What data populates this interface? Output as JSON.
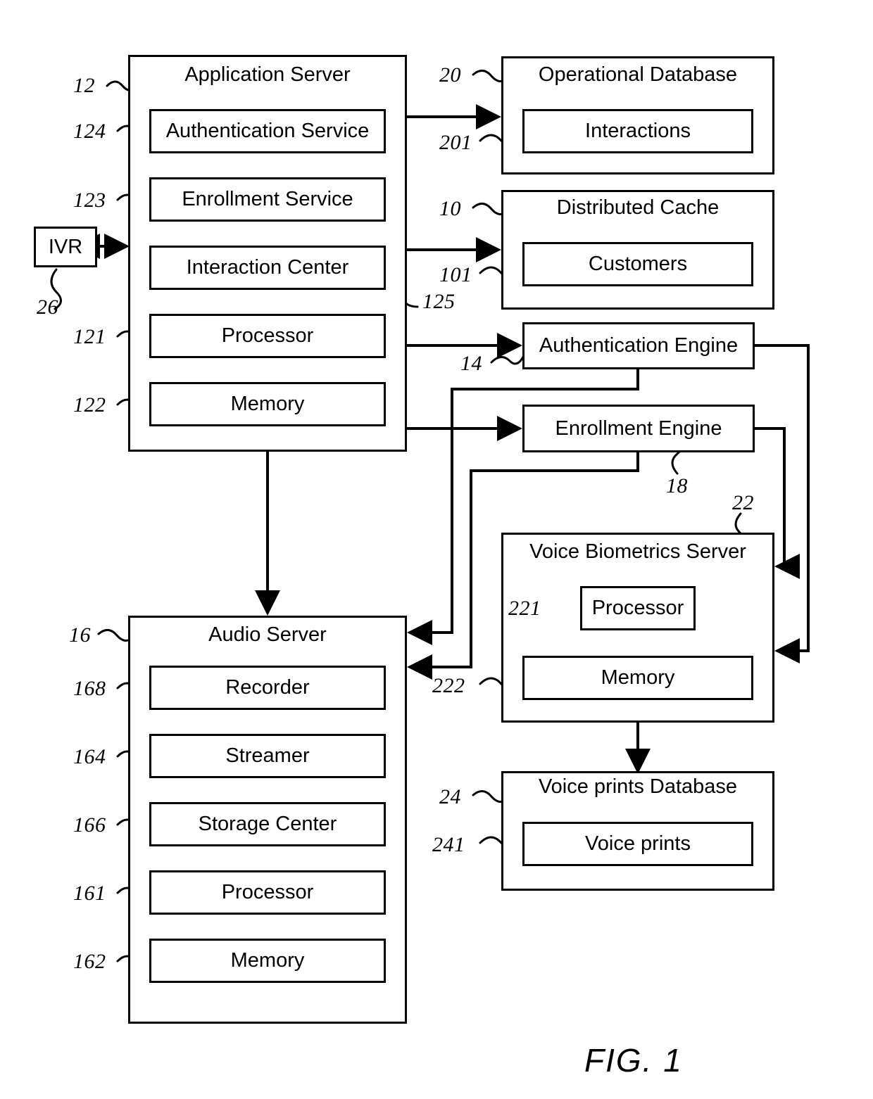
{
  "figure": {
    "label": "FIG. 1"
  },
  "nodes": {
    "ivr": {
      "title": "IVR",
      "ref": "26"
    },
    "application_server": {
      "title": "Application Server",
      "ref": "12",
      "components": [
        {
          "label": "Authentication Service",
          "ref": "124"
        },
        {
          "label": "Enrollment Service",
          "ref": "123"
        },
        {
          "label": "Interaction Center",
          "ref": "125"
        },
        {
          "label": "Processor",
          "ref": "121"
        },
        {
          "label": "Memory",
          "ref": "122"
        }
      ]
    },
    "operational_database": {
      "title": "Operational Database",
      "ref": "20",
      "components": [
        {
          "label": "Interactions",
          "ref": "201"
        }
      ]
    },
    "distributed_cache": {
      "title": "Distributed Cache",
      "ref": "10",
      "components": [
        {
          "label": "Customers",
          "ref": "101"
        }
      ]
    },
    "authentication_engine": {
      "title": "Authentication Engine",
      "ref": "14"
    },
    "enrollment_engine": {
      "title": "Enrollment Engine",
      "ref": "18"
    },
    "voice_biometrics_server": {
      "title": "Voice Biometrics Server",
      "ref": "22",
      "components": [
        {
          "label": "Processor",
          "ref": "221"
        },
        {
          "label": "Memory",
          "ref": "222"
        }
      ]
    },
    "voice_prints_database": {
      "title": "Voice prints Database",
      "ref": "24",
      "components": [
        {
          "label": "Voice prints",
          "ref": "241"
        }
      ]
    },
    "audio_server": {
      "title": "Audio Server",
      "ref": "16",
      "components": [
        {
          "label": "Recorder",
          "ref": "168"
        },
        {
          "label": "Streamer",
          "ref": "164"
        },
        {
          "label": "Storage Center",
          "ref": "166"
        },
        {
          "label": "Processor",
          "ref": "161"
        },
        {
          "label": "Memory",
          "ref": "162"
        }
      ]
    }
  },
  "colors": {
    "stroke": "#000000",
    "background": "#ffffff"
  }
}
